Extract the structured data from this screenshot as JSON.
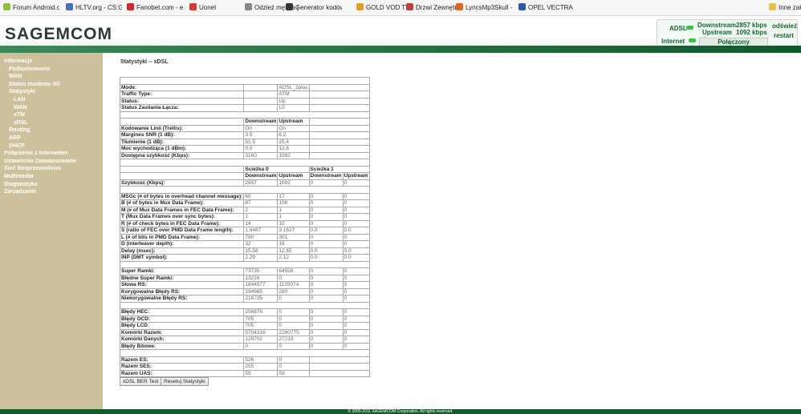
{
  "bookmarks": [
    {
      "label": "Forum Android.com.p",
      "color": "#8fc13e"
    },
    {
      "label": "HLTV.org - CS:GO Ne",
      "color": "#4a6fb5"
    },
    {
      "label": "Fanobet.com - esport",
      "color": "#d9262e"
    },
    {
      "label": "Uonet",
      "color": "#d63a2a"
    },
    {
      "label": "Odzież męska | Bluzy",
      "color": "#888888"
    },
    {
      "label": "Generator kodów QR",
      "color": "#333333"
    },
    {
      "label": "GOLD VOD TV",
      "color": "#e0a020"
    },
    {
      "label": "Drzwi Zewnętrzne Do",
      "color": "#c04040"
    },
    {
      "label": "LyricsMp3Skull - Pop",
      "color": "#e06a1a"
    },
    {
      "label": "OPEL VECTRA 1.8 lpg",
      "color": "#2a5ab0"
    },
    {
      "label": "Inne zakładki",
      "color": "#e8c340"
    }
  ],
  "header": {
    "logo": "SAGEMCOM"
  },
  "status": {
    "adsl": "ADSL",
    "internet": "Internet",
    "downstream_label": "Downstream",
    "downstream_value": "2857 kbps",
    "upstream_label": "Upstream",
    "upstream_value": "1092 kbps",
    "connected": "Połączony",
    "refresh": "odśwież",
    "restart": "restart",
    "led_color": "#2ecc40"
  },
  "nav": [
    {
      "label": "Informacje",
      "level": 0,
      "active": true
    },
    {
      "label": "Podsumowanie",
      "level": 1
    },
    {
      "label": "WAN",
      "level": 1
    },
    {
      "label": "Status modemu 3G",
      "level": 1
    },
    {
      "label": "Statystyki",
      "level": 1
    },
    {
      "label": "LAN",
      "level": 2
    },
    {
      "label": "WAN",
      "level": 2
    },
    {
      "label": "xTM",
      "level": 2
    },
    {
      "label": "xDSL",
      "level": 2
    },
    {
      "label": "Routing",
      "level": 1
    },
    {
      "label": "ARP",
      "level": 1
    },
    {
      "label": "DHCP",
      "level": 1
    },
    {
      "label": "Połączenie z Internetem",
      "level": 0
    },
    {
      "label": "Ustawienia Zaawansowane",
      "level": 0
    },
    {
      "label": "Sieć Bezprzewodowa",
      "level": 0
    },
    {
      "label": "Multimedia",
      "level": 0
    },
    {
      "label": "Diagnostyka",
      "level": 0
    },
    {
      "label": "Zarządzanie",
      "level": 0
    }
  ],
  "page_title": "Statystyki -- xDSL",
  "table_rows": [
    {
      "t": "sep"
    },
    {
      "t": "kv",
      "label": "Mode:",
      "value": "ADSL_2plus"
    },
    {
      "t": "kv",
      "label": "Traffic Type:",
      "value": "ATM"
    },
    {
      "t": "kv",
      "label": "Status:",
      "value": "Up"
    },
    {
      "t": "kv",
      "label": "Status Zasilania Łącza:",
      "value": "L0"
    },
    {
      "t": "sep"
    },
    {
      "t": "h2",
      "cols": [
        "Downstream",
        "Upstream"
      ]
    },
    {
      "t": "r2",
      "label": "Kodowanie Linii (Trellis):",
      "vals": [
        "On",
        "On"
      ]
    },
    {
      "t": "r2",
      "label": "Margines SNR (1 dB):",
      "vals": [
        "3.5",
        "6.2"
      ]
    },
    {
      "t": "r2",
      "label": "Tłumienie (1 dB):",
      "vals": [
        "51.5",
        "25.4"
      ]
    },
    {
      "t": "r2",
      "label": "Moc wychodząca (1 dBm):",
      "vals": [
        "0.0",
        "12.6"
      ]
    },
    {
      "t": "r2",
      "label": "Dostępna szybkość (Kbps):",
      "vals": [
        "3160",
        "1092"
      ]
    },
    {
      "t": "sep"
    },
    {
      "t": "hpath",
      "cols": [
        "Ścieżka 0",
        "Ścieżka 1"
      ]
    },
    {
      "t": "h4",
      "cols": [
        "Downstream",
        "Upstream",
        "Downstream",
        "Upstream"
      ]
    },
    {
      "t": "r4",
      "label": "Szybkość (Kbps):",
      "vals": [
        "2857",
        "1092",
        "0",
        "0"
      ]
    },
    {
      "t": "sep"
    },
    {
      "t": "r4",
      "label": "MSGc (# of bytes in overhead channel message):",
      "vals": [
        "60",
        "17",
        "0",
        "0"
      ]
    },
    {
      "t": "r4",
      "label": "B (# of bytes in Mux Data Frame):",
      "vals": [
        "87",
        "108",
        "0",
        "0"
      ]
    },
    {
      "t": "r4",
      "label": "M (# of Mux Data Frames in FEC Data Frame):",
      "vals": [
        "2",
        "1",
        "0",
        "0"
      ]
    },
    {
      "t": "r4",
      "label": "T (Mux Data Frames over sync bytes):",
      "vals": [
        "1",
        "1",
        "0",
        "0"
      ]
    },
    {
      "t": "r4",
      "label": "R (# of check bytes in FEC Data Frame):",
      "vals": [
        "14",
        "10",
        "0",
        "0"
      ]
    },
    {
      "t": "r4",
      "label": "S (ratio of FEC over PMD Data Frame length):",
      "vals": [
        "1.9487",
        "3.1627",
        "0.0",
        "0.0"
      ]
    },
    {
      "t": "r4",
      "label": "L (# of bits in PMD Data Frame):",
      "vals": [
        "780",
        "301",
        "0",
        "0"
      ]
    },
    {
      "t": "r4",
      "label": "D (interleaver depth):",
      "vals": [
        "32",
        "16",
        "0",
        "0"
      ]
    },
    {
      "t": "r4",
      "label": "Delay (msec):",
      "vals": [
        "15.58",
        "12.65",
        "0.0",
        "0.0"
      ]
    },
    {
      "t": "r4",
      "label": "INP (DMT symbol):",
      "vals": [
        "2.29",
        "2.12",
        "0.0",
        "0.0"
      ]
    },
    {
      "t": "sep"
    },
    {
      "t": "r4",
      "label": "Super Ramki:",
      "vals": [
        "73735",
        "64558",
        "0",
        "0"
      ]
    },
    {
      "t": "r4",
      "label": "Błędne Super Ramki:",
      "vals": [
        "13216",
        "0",
        "0",
        "0"
      ]
    },
    {
      "t": "r4",
      "label": "Słowa RS:",
      "vals": [
        "1844577",
        "1135074",
        "0",
        "0"
      ]
    },
    {
      "t": "r4",
      "label": "Korygowalne Błędy RS:",
      "vals": [
        "194665",
        "280",
        "0",
        "0"
      ]
    },
    {
      "t": "r4",
      "label": "Niekorygowalne Błędy RS:",
      "vals": [
        "218725",
        "0",
        "0",
        "0"
      ]
    },
    {
      "t": "sep"
    },
    {
      "t": "r4",
      "label": "Błędy HEC:",
      "vals": [
        "256876",
        "0",
        "0",
        "0"
      ]
    },
    {
      "t": "r4",
      "label": "Błędy OCD:",
      "vals": [
        "705",
        "0",
        "0",
        "0"
      ]
    },
    {
      "t": "r4",
      "label": "Błędy LCD:",
      "vals": [
        "705",
        "0",
        "0",
        "0"
      ]
    },
    {
      "t": "r4",
      "label": "Komórki Razem:",
      "vals": [
        "5704316",
        "2280775",
        "0",
        "0"
      ]
    },
    {
      "t": "r4",
      "label": "Komórki Danych:",
      "vals": [
        "129702",
        "27233",
        "0",
        "0"
      ]
    },
    {
      "t": "r4",
      "label": "Błędy Bitowe:",
      "vals": [
        "0",
        "0",
        "0",
        "0"
      ]
    },
    {
      "t": "sep"
    },
    {
      "t": "r2",
      "label": "Razem ES:",
      "vals": [
        "526",
        "0"
      ]
    },
    {
      "t": "r2",
      "label": "Razem SES:",
      "vals": [
        "255",
        "0"
      ]
    },
    {
      "t": "r2",
      "label": "Razem UAS:",
      "vals": [
        "59",
        "59"
      ]
    }
  ],
  "buttons": {
    "ber_test": "xDSL BER Test",
    "reset": "Resetuj Statystyki"
  },
  "footer": "© 2005-2011 SAGEMCOM Corporation. All rights reserved."
}
